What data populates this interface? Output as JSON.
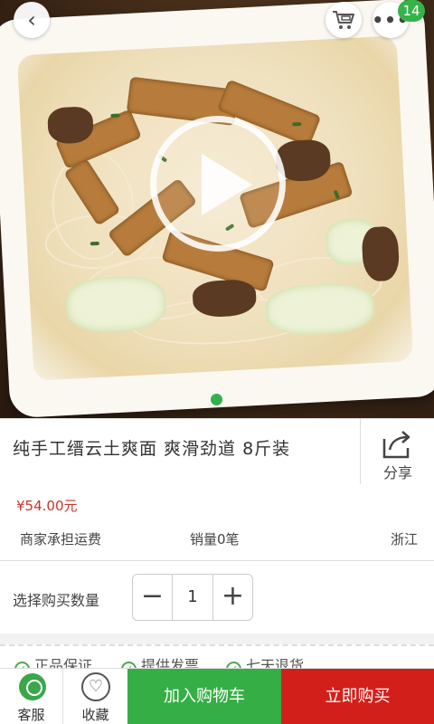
{
  "header": {
    "notification_count": "14",
    "back_icon": "chevron-left-icon",
    "cart_icon": "cart-icon",
    "more_icon": "more-dots-icon"
  },
  "gallery": {
    "play_icon": "play-icon",
    "indicator_count": 1,
    "indicator_color": "#33b14b"
  },
  "product": {
    "title": "纯手工缙云土爽面  爽滑劲道  8斤装",
    "share_label": "分享",
    "price": "¥54.00元",
    "shipping": "商家承担运费",
    "sales": "销量0笔",
    "location": "浙江"
  },
  "quantity": {
    "label": "选择购买数量",
    "value": "1",
    "minus": "−",
    "plus": "+"
  },
  "guarantees": [
    "正品保证",
    "提供发票",
    "七天退货"
  ],
  "bottom_bar": {
    "service_label": "客服",
    "favorite_label": "收藏",
    "add_to_cart": "加入购物车",
    "buy_now": "立即购买"
  },
  "colors": {
    "accent_green": "#35ae46",
    "buy_red": "#d31f1a",
    "price_red": "#c7352c"
  }
}
